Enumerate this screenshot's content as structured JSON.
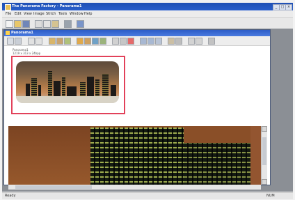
{
  "app": {
    "title": "The Panorama Factory - Panorama1",
    "window_buttons": [
      "_",
      "□",
      "×"
    ]
  },
  "menu": [
    "File",
    "Edit",
    "View",
    "Image",
    "Stitch",
    "Tools",
    "Window",
    "Help"
  ],
  "doc_window": {
    "title": "Panorama1"
  },
  "info_lines": [
    "Panorama1",
    "1219 x 313 x 24bpp"
  ],
  "status": {
    "left": "Ready",
    "right": "NUM"
  },
  "colors": {
    "titlebar": "#1e4fb4",
    "selection_border": "#e2415a",
    "desktop": "#8b8f95"
  },
  "icons": {
    "app": "panorama-app-icon",
    "toolbar": [
      "new-icon",
      "open-icon",
      "save-icon",
      "cut-icon",
      "copy-icon",
      "paste-icon",
      "print-icon",
      "help-icon"
    ]
  }
}
